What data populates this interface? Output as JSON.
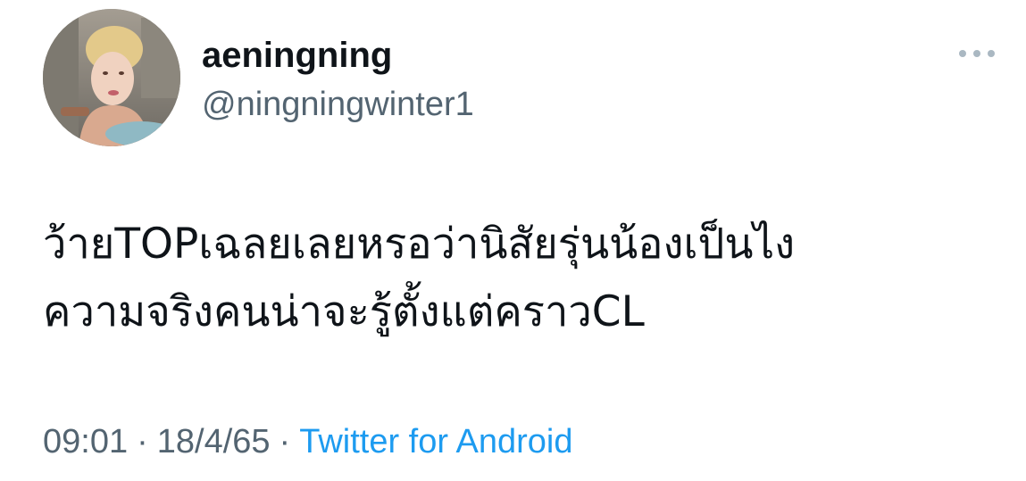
{
  "user": {
    "display_name": "aeningning",
    "handle": "@ningningwinter1",
    "avatar_icon": "profile-photo"
  },
  "more_icon": "ellipsis-icon",
  "tweet": {
    "text_lines": [
      "ว้ายTOPเฉลยเลยหรอว่านิสัยรุ่นน้องเป็นไง",
      "ความจริงคนน่าจะรู้ตั้งแต่คราวCL"
    ]
  },
  "meta": {
    "time": "09:01",
    "separator": "·",
    "date": "18/4/65",
    "source": "Twitter for Android"
  },
  "colors": {
    "text_primary": "#0f1419",
    "text_secondary": "#536471",
    "link": "#1d9bf0"
  }
}
